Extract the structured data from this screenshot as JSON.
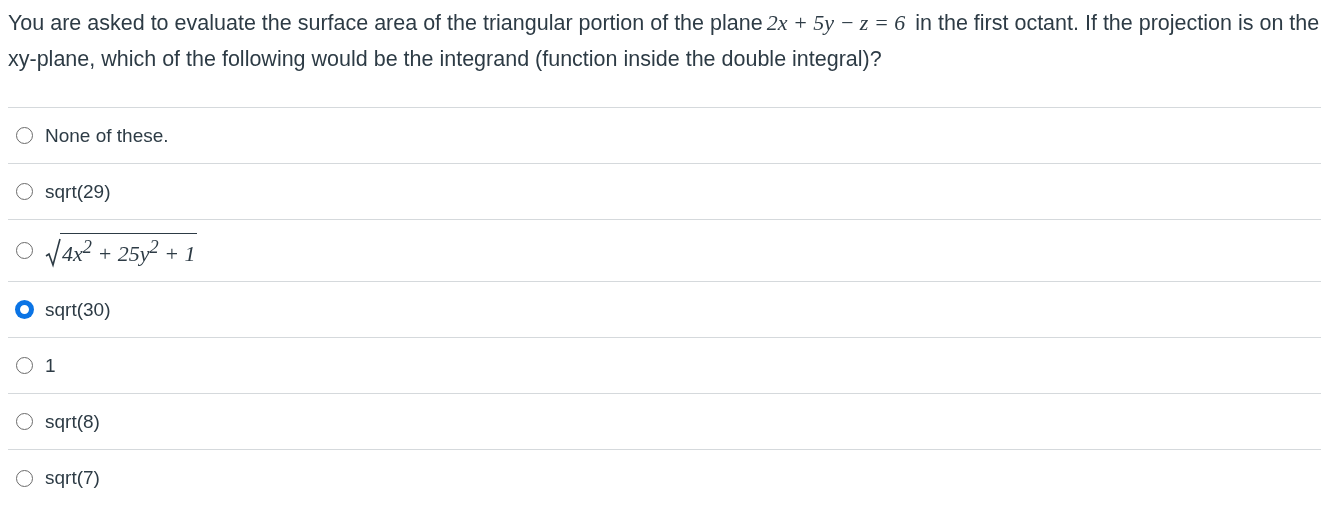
{
  "question": {
    "text_before": "You are asked to evaluate the surface area of the triangular portion of the plane",
    "equation": "2x + 5y − z = 6",
    "text_after": "in the first octant.  If the projection is on the xy-plane, which of the following would be the integrand (function inside the double integral)?"
  },
  "options": [
    {
      "kind": "text",
      "label": "None of these.",
      "selected": false
    },
    {
      "kind": "text",
      "label": "sqrt(29)",
      "selected": false
    },
    {
      "kind": "sqrt",
      "label": "4x$^{2}$ + 25y$^{2}$ + 1",
      "selected": false
    },
    {
      "kind": "text",
      "label": "sqrt(30)",
      "selected": true
    },
    {
      "kind": "text",
      "label": "1",
      "selected": false
    },
    {
      "kind": "text",
      "label": "sqrt(8)",
      "selected": false
    },
    {
      "kind": "text",
      "label": "sqrt(7)",
      "selected": false
    }
  ]
}
